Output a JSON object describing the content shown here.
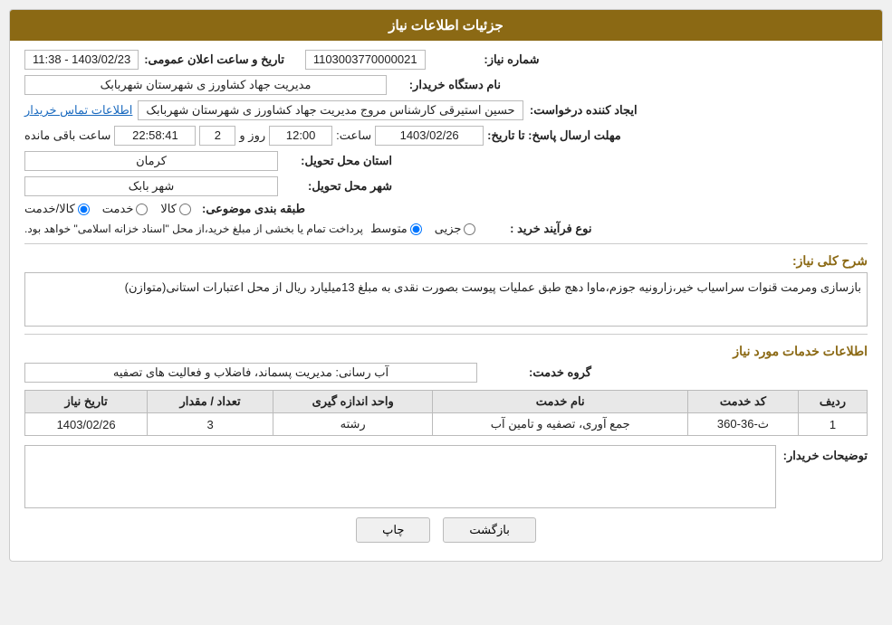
{
  "header": {
    "title": "جزئیات اطلاعات نیاز"
  },
  "fields": {
    "need_number_label": "شماره نیاز:",
    "need_number_value": "1103003770000021",
    "announcement_date_label": "تاریخ و ساعت اعلان عمومی:",
    "announcement_date_value": "1403/02/23 - 11:38",
    "buyer_org_label": "نام دستگاه خریدار:",
    "buyer_org_value": "مدیریت جهاد کشاورز ی شهرستان شهربابک",
    "creator_label": "ایجاد کننده درخواست:",
    "creator_value": "حسین استیرقی کارشناس مروج مدیریت جهاد کشاورز ی شهرستان شهربابک",
    "contact_link": "اطلاعات تماس خریدار",
    "deadline_label": "مهلت ارسال پاسخ: تا تاریخ:",
    "deadline_date": "1403/02/26",
    "deadline_time_label": "ساعت:",
    "deadline_time": "12:00",
    "deadline_days_label": "روز و",
    "deadline_days": "2",
    "deadline_remaining_label": "ساعت باقی مانده",
    "deadline_remaining": "22:58:41",
    "province_label": "استان محل تحویل:",
    "province_value": "کرمان",
    "city_label": "شهر محل تحویل:",
    "city_value": "شهر بابک",
    "category_label": "طبقه بندی موضوعی:",
    "category_kala": "کالا",
    "category_khedmat": "خدمت",
    "category_kala_khedmat": "کالا/خدمت",
    "process_type_label": "نوع فرآیند خرید :",
    "process_jozii": "جزیی",
    "process_motavaset": "متوسط",
    "process_note": "پرداخت تمام یا بخشی از مبلغ خرید،از محل \"اسناد خزانه اسلامی\" خواهد بود.",
    "description_section_title": "شرح کلی نیاز:",
    "description_text": "بازسازی ومرمت قنوات سراسیاب خیر،زارونیه جوزم،ماوا دهج طبق عملیات پیوست بصورت نقدی به مبلغ 13میلیارد ریال از محل اعتبارات استانی(متوازن)",
    "services_section_title": "اطلاعات خدمات مورد نیاز",
    "service_group_label": "گروه خدمت:",
    "service_group_value": "آب رسانی: مدیریت پسماند، فاضلاب و فعالیت های تصفیه",
    "table_headers": {
      "row_num": "ردیف",
      "service_code": "کد خدمت",
      "service_name": "نام خدمت",
      "unit": "واحد اندازه گیری",
      "quantity": "تعداد / مقدار",
      "date": "تاریخ نیاز"
    },
    "table_rows": [
      {
        "row_num": "1",
        "service_code": "ث-36-360",
        "service_name": "جمع آوری، تصفیه و تامین آب",
        "unit": "رشته",
        "quantity": "3",
        "date": "1403/02/26"
      }
    ],
    "buyer_notes_label": "توضیحات خریدار:",
    "buyer_notes_value": ""
  },
  "buttons": {
    "back": "بازگشت",
    "print": "چاپ"
  }
}
